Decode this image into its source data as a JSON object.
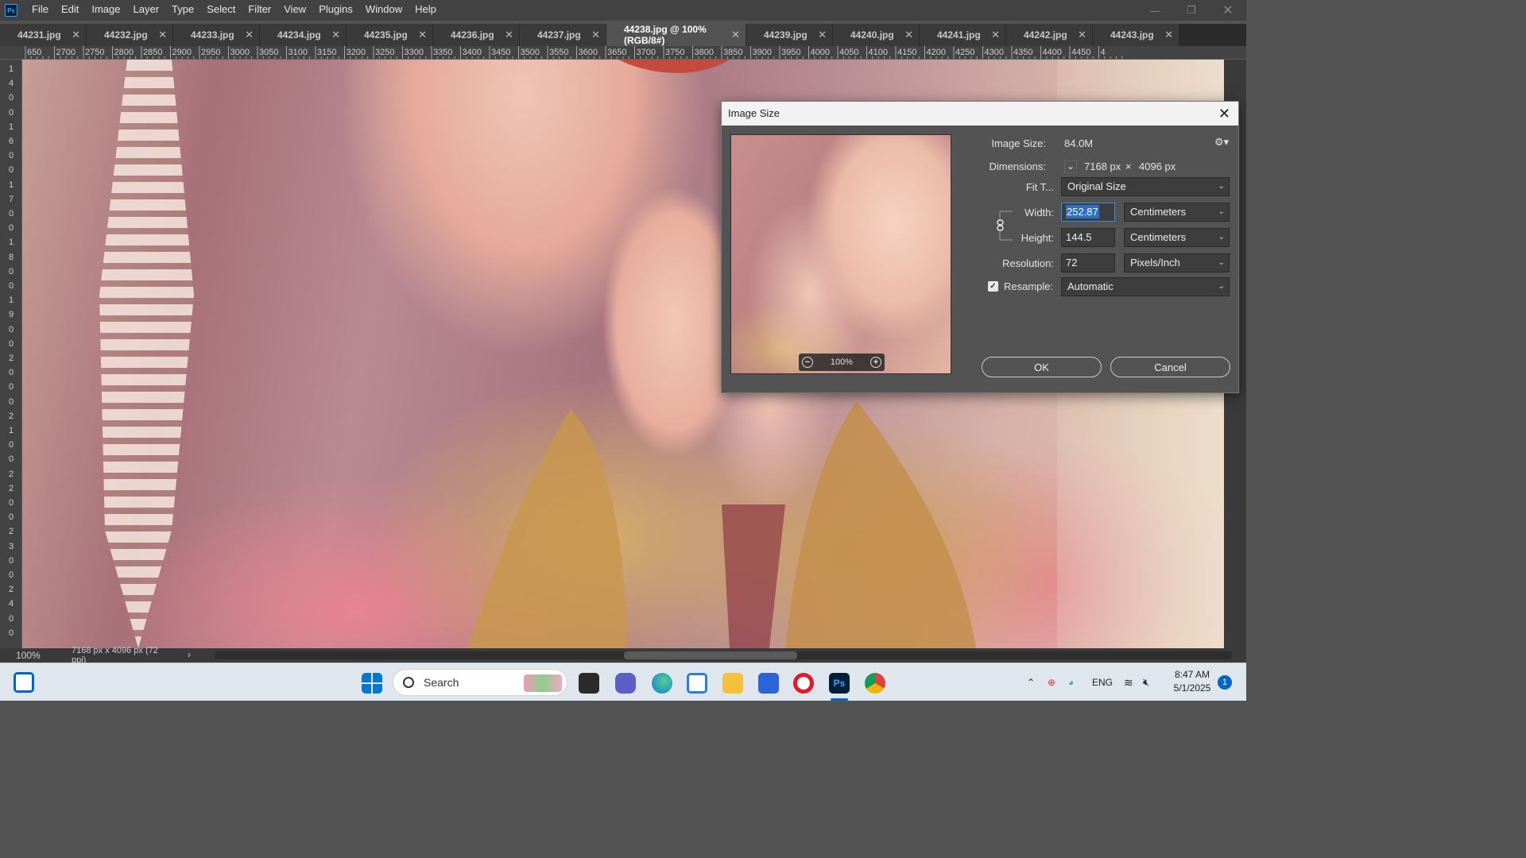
{
  "app": {
    "logo": "Ps"
  },
  "menu": [
    "File",
    "Edit",
    "Image",
    "Layer",
    "Type",
    "Select",
    "Filter",
    "View",
    "Plugins",
    "Window",
    "Help"
  ],
  "tabs": [
    {
      "label": "44231.jpg",
      "active": false
    },
    {
      "label": "44232.jpg",
      "active": false
    },
    {
      "label": "44233.jpg",
      "active": false
    },
    {
      "label": "44234.jpg",
      "active": false
    },
    {
      "label": "44235.jpg",
      "active": false
    },
    {
      "label": "44236.jpg",
      "active": false
    },
    {
      "label": "44237.jpg",
      "active": false
    },
    {
      "label": "44238.jpg @ 100% (RGB/8#)",
      "active": true
    },
    {
      "label": "44239.jpg",
      "active": false
    },
    {
      "label": "44240.jpg",
      "active": false
    },
    {
      "label": "44241.jpg",
      "active": false
    },
    {
      "label": "44242.jpg",
      "active": false
    },
    {
      "label": "44243.jpg",
      "active": false
    }
  ],
  "ruler_h_labels": [
    "650",
    "2700",
    "2750",
    "2800",
    "2850",
    "2900",
    "2950",
    "3000",
    "3050",
    "3100",
    "3150",
    "3200",
    "3250",
    "3300",
    "3350",
    "3400",
    "3450",
    "3500",
    "3550",
    "3600",
    "3650",
    "3700",
    "3750",
    "3800",
    "3850",
    "3900",
    "3950",
    "4000",
    "4050",
    "4100",
    "4150",
    "4200",
    "4250",
    "4300",
    "4350",
    "4400",
    "4450",
    "4"
  ],
  "ruler_v_labels": [
    "1",
    "4",
    "0",
    "0",
    "1",
    "6",
    "0",
    "0",
    "1",
    "7",
    "0",
    "0",
    "1",
    "8",
    "0",
    "0",
    "1",
    "9",
    "0",
    "0",
    "2",
    "0",
    "0",
    "0",
    "2",
    "1",
    "0",
    "0",
    "2",
    "2",
    "0",
    "0",
    "2",
    "3",
    "0",
    "0",
    "2",
    "4",
    "0",
    "0"
  ],
  "status": {
    "zoom": "100%",
    "doc_info": "7168 px x 4096 px (72 ppi)"
  },
  "dialog": {
    "title": "Image Size",
    "image_size_label": "Image Size:",
    "image_size_value": "84.0M",
    "dimensions_label": "Dimensions:",
    "dim_width": "7168 px",
    "dim_times": "×",
    "dim_height": "4096 px",
    "fit_label": "Fit T...",
    "fit_value": "Original Size",
    "width_label": "Width:",
    "width_value": "252.87",
    "width_unit": "Centimeters",
    "height_label": "Height:",
    "height_value": "144.5",
    "height_unit": "Centimeters",
    "resolution_label": "Resolution:",
    "resolution_value": "72",
    "resolution_unit": "Pixels/Inch",
    "resample_label": "Resample:",
    "resample_checked": true,
    "resample_value": "Automatic",
    "preview_zoom": "100%",
    "ok_label": "OK",
    "cancel_label": "Cancel"
  },
  "taskbar": {
    "search_label": "Search",
    "lang": "ENG",
    "time": "8:47 AM",
    "date": "5/1/2025",
    "notification_count": "1"
  }
}
